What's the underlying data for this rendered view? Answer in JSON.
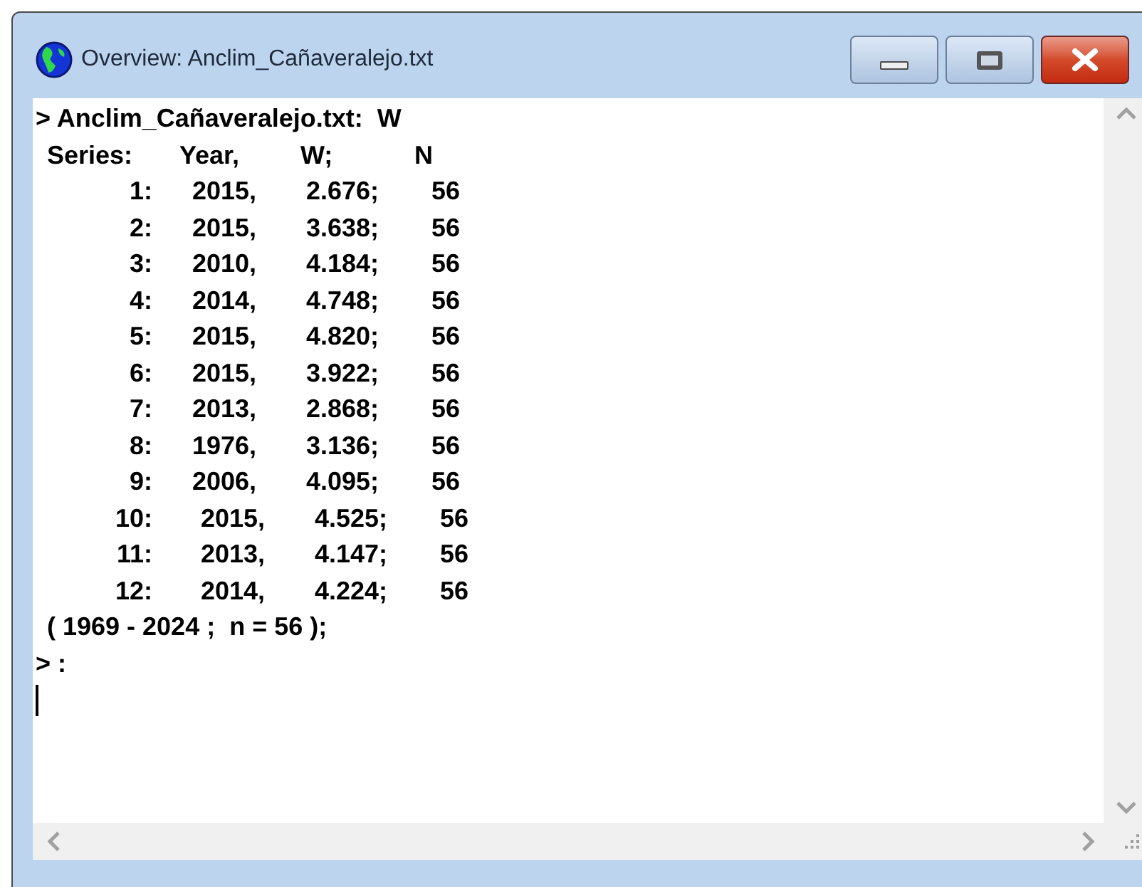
{
  "window": {
    "title": "Overview: Anclim_Cañaveralejo.txt"
  },
  "console": {
    "command_line": "> Anclim_Cañaveralejo.txt:  W",
    "header": [
      "Series:",
      "Year,",
      "W;",
      "N"
    ],
    "rows": [
      {
        "index": "1:",
        "year": "2015,",
        "value": "2.676;",
        "n": "56"
      },
      {
        "index": "2:",
        "year": "2015,",
        "value": "3.638;",
        "n": "56"
      },
      {
        "index": "3:",
        "year": "2010,",
        "value": "4.184;",
        "n": "56"
      },
      {
        "index": "4:",
        "year": "2014,",
        "value": "4.748;",
        "n": "56"
      },
      {
        "index": "5:",
        "year": "2015,",
        "value": "4.820;",
        "n": "56"
      },
      {
        "index": "6:",
        "year": "2015,",
        "value": "3.922;",
        "n": "56"
      },
      {
        "index": "7:",
        "year": "2013,",
        "value": "2.868;",
        "n": "56"
      },
      {
        "index": "8:",
        "year": "1976,",
        "value": "3.136;",
        "n": "56"
      },
      {
        "index": "9:",
        "year": "2006,",
        "value": "4.095;",
        "n": "56"
      },
      {
        "index": "10:",
        "year": "2015,",
        "value": "4.525;",
        "n": "56"
      },
      {
        "index": "11:",
        "year": "2013,",
        "value": "4.147;",
        "n": "56"
      },
      {
        "index": "12:",
        "year": "2014,",
        "value": "4.224;",
        "n": "56"
      }
    ],
    "summary": "( 1969 - 2024 ;  n = 56 );",
    "prompt": "> :"
  }
}
